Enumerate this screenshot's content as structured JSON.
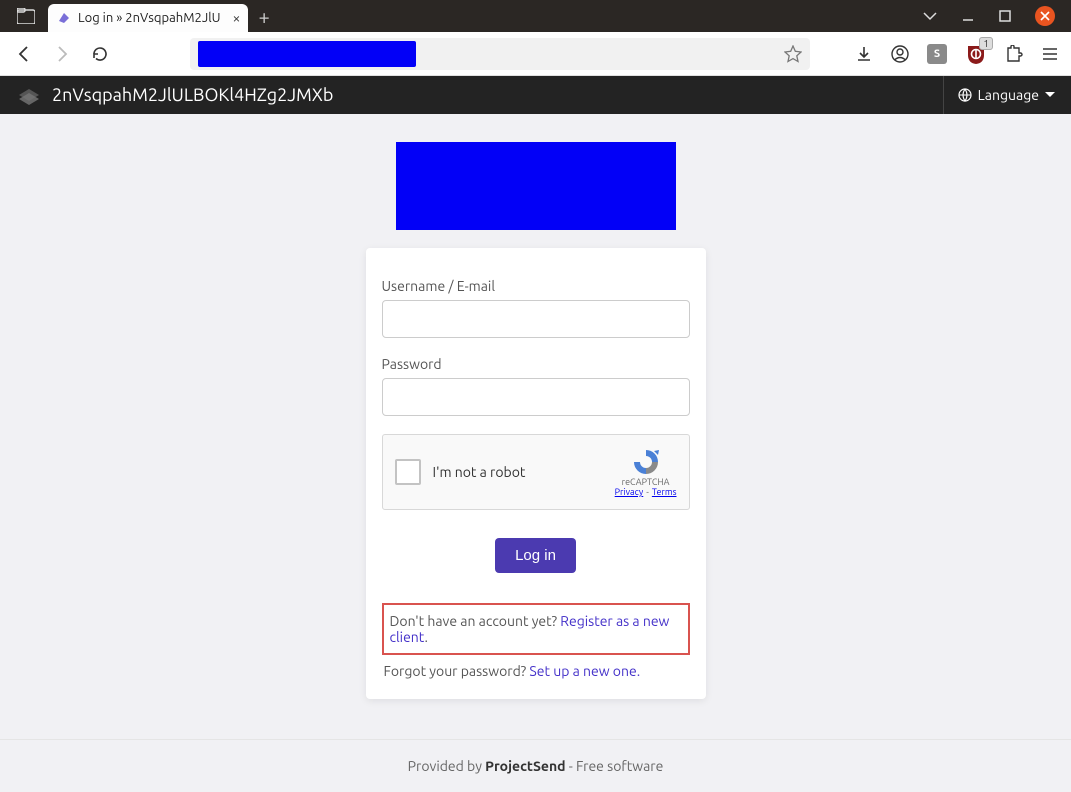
{
  "browser": {
    "tab_title": "Log in » 2nVsqpahM2JlU",
    "star_tooltip": "Bookmark"
  },
  "toolbar_icons": {
    "s_badge": "S",
    "ub_count": "1"
  },
  "appbar": {
    "site_title": "2nVsqpahM2JlULBOKl4HZg2JMXb",
    "language_label": "Language"
  },
  "login": {
    "username_label": "Username / E-mail",
    "password_label": "Password",
    "captcha_text": "I'm not a robot",
    "captcha_brand": "reCAPTCHA",
    "captcha_privacy": "Privacy",
    "captcha_terms": "Terms",
    "login_button": "Log in",
    "register_prompt": "Don't have an account yet? ",
    "register_link": "Register as a new client",
    "register_period": ".",
    "forgot_prompt": "Forgot your password? ",
    "forgot_link": "Set up a new one.",
    "username_value": "",
    "password_value": ""
  },
  "footer": {
    "provided_by": "Provided by ",
    "project_name": "ProjectSend",
    "tagline": " - Free software"
  }
}
